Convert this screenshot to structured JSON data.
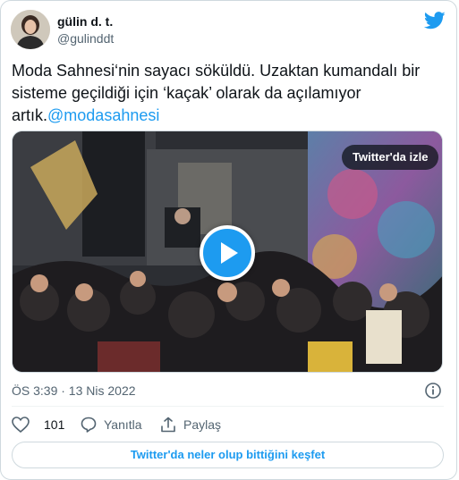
{
  "author": {
    "name": "gülin d. t.",
    "handle": "@gulinddt"
  },
  "tweet": {
    "text": "Moda Sahnesi‘nin sayacı söküldü. Uzaktan kumandalı bir sisteme geçildiği için ‘kaçak’ olarak da açılamıyor artık.",
    "mention": "@modasahnesi",
    "timestamp": "ÖS 3:39 · 13 Nis 2022"
  },
  "media": {
    "watch_label": "Twitter'da izle"
  },
  "actions": {
    "like_count": "101",
    "reply_label": "Yanıtla",
    "share_label": "Paylaş"
  },
  "explore_label": "Twitter'da neler olup bittiğini keşfet",
  "colors": {
    "accent": "#1d9bf0",
    "text": "#0f1419",
    "muted": "#536471",
    "border": "#cfd9de"
  },
  "icons": [
    "twitter-bird-icon",
    "play-icon",
    "info-icon",
    "heart-icon",
    "reply-icon",
    "share-icon"
  ]
}
